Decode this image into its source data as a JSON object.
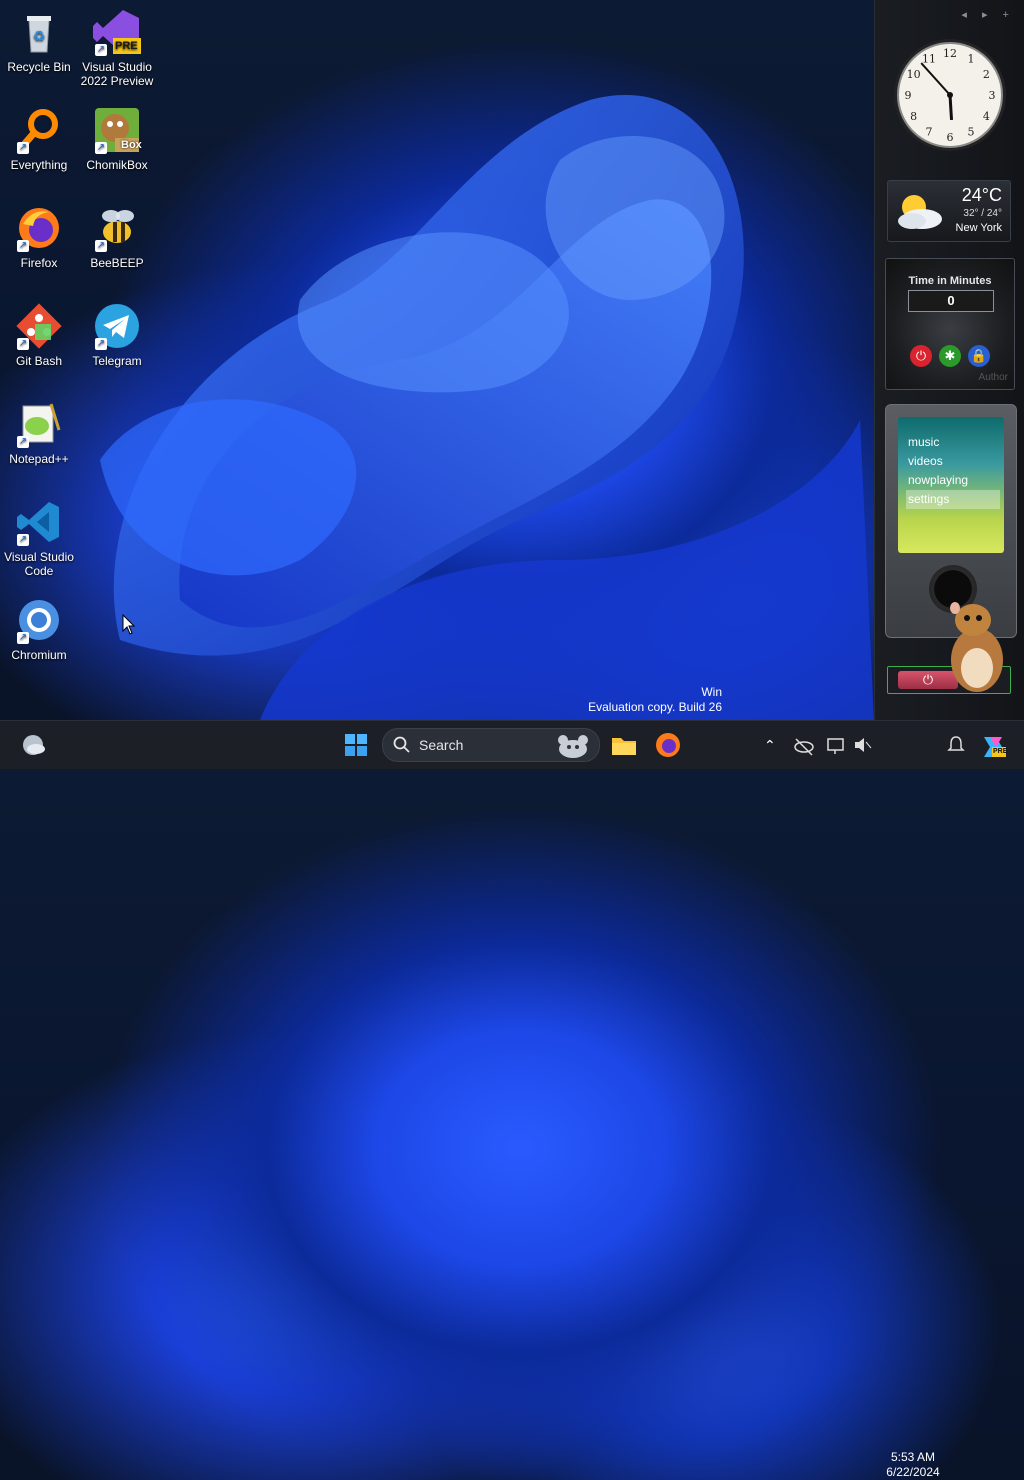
{
  "desktop_icons": [
    {
      "label": "Recycle Bin"
    },
    {
      "label": "Visual Studio 2022 Preview",
      "badge": "PRE"
    },
    {
      "label": "Everything"
    },
    {
      "label": "ChomikBox",
      "badge": "Box"
    },
    {
      "label": "Firefox"
    },
    {
      "label": "BeeBEEP"
    },
    {
      "label": "Git Bash"
    },
    {
      "label": "Telegram"
    },
    {
      "label": "Notepad++"
    },
    {
      "label": "Visual Studio Code"
    },
    {
      "label": "Chromium"
    }
  ],
  "sidebar": {
    "controls": "◂ ▸ +",
    "clock": {
      "hour": 5,
      "minute": 53
    },
    "weather": {
      "temp": "24°C",
      "range": "32° / 24°",
      "city": "New York"
    },
    "timer": {
      "title": "Time in Minutes",
      "value": "0",
      "author": "Author"
    },
    "zune": {
      "menu": [
        "music",
        "videos",
        "nowplaying",
        "settings"
      ],
      "selected": 3
    }
  },
  "watermark": {
    "line1": "Win",
    "line2": "Evaluation copy. Build 26"
  },
  "taskbar": {
    "search_label": "Search",
    "time": "5:53 AM",
    "date": "6/22/2024",
    "copilot_badge": "PRE"
  },
  "colors": {
    "accent": "#1d47e6",
    "taskbar": "#1c1f26",
    "sidebar": "#16181c"
  }
}
